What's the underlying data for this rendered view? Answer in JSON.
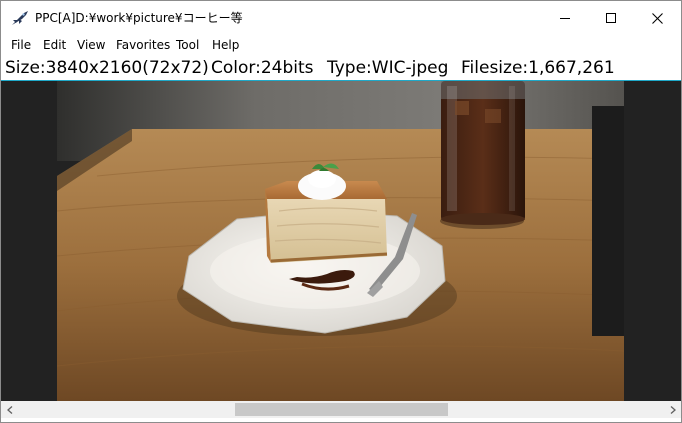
{
  "window": {
    "title": "PPC[A]D:¥work¥picture¥コーヒー等"
  },
  "caption_buttons": {
    "minimize_icon": "minimize-icon",
    "maximize_icon": "maximize-icon",
    "close_icon": "close-icon"
  },
  "menu": {
    "items": [
      {
        "label": "File"
      },
      {
        "label": "Edit"
      },
      {
        "label": "View"
      },
      {
        "label": "Favorites"
      },
      {
        "label": "Tool"
      },
      {
        "label": "Help"
      }
    ]
  },
  "info": {
    "size": "Size:3840x2160(72x72)",
    "color": "Color:24bits",
    "type": "Type:WIC-jpeg",
    "filesize": "Filesize:1,667,261"
  },
  "image": {
    "subject": "photo of a slice of apple cake with whipped cream and mint on a white plate with a fork, and a glass of iced coffee on a wooden table"
  },
  "colors": {
    "accent_line": "#1fa9c9",
    "viewer_background": "#222222",
    "scrollbar_track": "#f0f0f0",
    "scrollbar_thumb": "#c8c8c8"
  }
}
